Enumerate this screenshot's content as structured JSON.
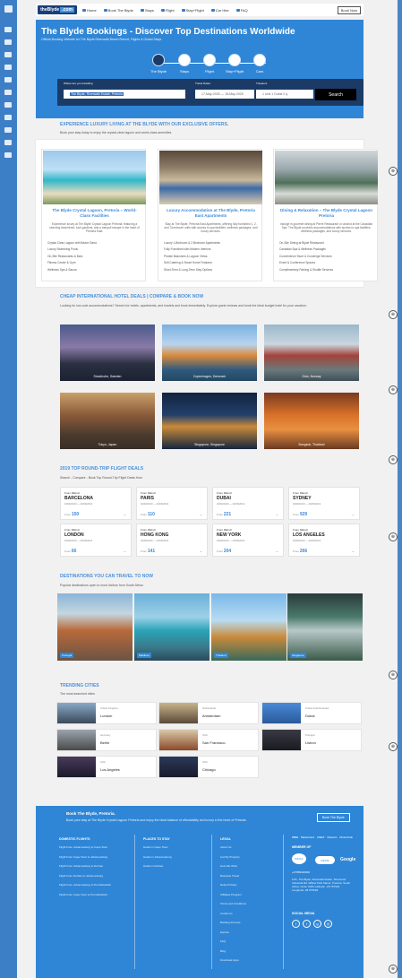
{
  "nav": {
    "logo_a": "theBlyde",
    "logo_b": ".com",
    "links": [
      "Home",
      "Book The Blyde",
      "Stays",
      "Flight",
      "Stay+Flight",
      "Car Hire",
      "FAQ"
    ],
    "book_now": "Book Now"
  },
  "hero": {
    "title": "The Blyde Bookings - Discover Top Destinations Worldwide",
    "subtitle": "Official Booking Website for The Blyde Riverwalk Beach Resort, Flights & Global Stays",
    "steps": [
      "The Blyde",
      "Stays",
      "Flight",
      "Stay+Flight",
      "Cars"
    ],
    "search": {
      "dest_label": "Where are you travelling",
      "dest_value": "The Blyde, Riverwalk Estate, Pretoria",
      "dates_label": "Travel Dates",
      "dates_value": "17-May-2025 — 18-May-2025",
      "travelers_label": "Travelers",
      "travelers_value": "1 Unit 1 Guest 0 q",
      "button": "Search"
    }
  },
  "luxury": {
    "title": "EXPERIENCE LUXURY LIVING AT THE BLYDE WITH OUR EXCLUSIVE OFFERS.",
    "subtitle": "Book your stay today to enjoy the crystal-clear lagoon and world-class amenities.",
    "cards": [
      {
        "title": "The Blyde Crystal Lagoon, Pretoria – World-Class Facilities",
        "desc": "Experience luxury at The Blyde Crystal Lagoon Pretoria, featuring a stunning beachfront, lush gardens, and a tranquil escape in the heart of Pretoria East.",
        "items": [
          "Crystal Clear Lagoon with Beach Sand",
          "Luxury Swimming Pools",
          "On-Site Restaurants & Bars",
          "Fitness Center & Gym",
          "Wellness Spa & Sauna"
        ]
      },
      {
        "title": "Luxury Accommodation at The Blyde, Pretoria East Apartments",
        "desc": "Stay at The Blyde, Pretoria East Apartments, offering fully furnished 1, 2, and 3-bedroom units with access to spa facilities, wellness packages, and luxury services.",
        "items": [
          "Luxury 1-Bedroom & 2-Bedroom Apartments",
          "Fully Furnished with Modern Interiors",
          "Private Balconies & Lagoon Views",
          "Self-Catering & Smart Home Features",
          "Short-Term & Long-Term Stay Options"
        ]
      },
      {
        "title": "Dining & Relaxation – The Blyde Crystal Lagoon Pretoria",
        "desc": "Indulge in gourmet dining at Pierre Restaurant or unwind at the Canadian Spa. The Blyde provides accommodations with access to spa facilities, wellness packages, and luxury services.",
        "items": [
          "On-Site Dining at Blyde Restaurant",
          "Canadian Spa & Wellness Packages",
          "Convenience Store & Concierge Services",
          "Event & Conference Spaces",
          "Complimentary Parking & Shuttle Services"
        ]
      }
    ]
  },
  "cheap": {
    "title": "CHEAP INTERNATIONAL HOTEL DEALS | COMPARE & BOOK NOW",
    "subtitle": "Looking for low-cost accommodations? Search for hotels, apartments, and hostels and book immediately. Explore guest reviews and book the ideal budget hotel for your vacation.",
    "cities": [
      "Stockholm, Sweden",
      "Copenhagen, Denmark",
      "Oslo, Norway",
      "Tokyo, Japan",
      "Singapore, Singapore",
      "Bangkok, Thailand"
    ]
  },
  "flights": {
    "title": "2019 TOP ROUND-TRIP FLIGHT DEALS",
    "subtitle": "Search - Compare - Book Top Round-Trip Flight Deals from",
    "from_label": "From",
    "dates": "04/09/2019  —  20/09/2019",
    "price_label": "From",
    "cards": [
      {
        "from": "DELHI",
        "to": "BARCELONA",
        "price": "150"
      },
      {
        "from": "DELHI",
        "to": "PARIS",
        "price": "110"
      },
      {
        "from": "DELHI",
        "to": "DUBAI",
        "price": "221"
      },
      {
        "from": "DELHI",
        "to": "SYDNEY",
        "price": "929"
      },
      {
        "from": "DELHI",
        "to": "LONDON",
        "price": "66"
      },
      {
        "from": "DELHI",
        "to": "HONG KONG",
        "price": "141"
      },
      {
        "from": "DELHI",
        "to": "NEW YORK",
        "price": "204"
      },
      {
        "from": "DELHI",
        "to": "LOS ANGELES",
        "price": "266"
      }
    ]
  },
  "destinations": {
    "title": "DESTINATIONS YOU CAN TRAVEL TO NOW",
    "subtitle": "Popular destinations open to most visitors from South Africa",
    "tags": [
      "Portugal",
      "Maldives",
      "Thailand",
      "Singapore"
    ]
  },
  "trending": {
    "title": "TRENDING CITIES",
    "subtitle": "The most searched cities",
    "cities": [
      {
        "country": "United Kingdom",
        "name": "London"
      },
      {
        "country": "Netherlands",
        "name": "Amsterdam"
      },
      {
        "country": "United Arab Emirates",
        "name": "Dubai"
      },
      {
        "country": "Germany",
        "name": "Berlin"
      },
      {
        "country": "USA",
        "name": "San Francisco"
      },
      {
        "country": "Portugal",
        "name": "Lisbon"
      },
      {
        "country": "USA",
        "name": "Los Angeles"
      },
      {
        "country": "USA",
        "name": "Chicago"
      }
    ]
  },
  "footer": {
    "cta_title": "Book The Blyde, Pretoria.",
    "cta_text": "Book your stay at The Blyde Crystal Lagoon Pretoria and enjoy the ideal balance of affordability and luxury in the heart of Pretoria.",
    "cta_button": "Book The Blyde",
    "col1_title": "DOMESTIC FLIGHTS",
    "col1": [
      "Flight From Johannesburg to Cape Town",
      "Flight From Cape Town to Johannesburg",
      "Flight From Johannesburg to Durban",
      "Flight From Durban to Johannesburg",
      "Flight From Johannesburg to Port Elizabeth",
      "Flight From Cape Town to Port Elizabeth"
    ],
    "col2_title": "PLACES TO STAY",
    "col2": [
      "Hotels in Cape Town",
      "Hotels in Johannesburg",
      "Hotels in Durban"
    ],
    "col3_title": "LEGAL",
    "col3": [
      "About Us",
      "List My Property",
      "How We Work",
      "Business Travel",
      "Refund Policy",
      "Affiliates Program",
      "Terms and Conditions",
      "contact us",
      "Booking Process",
      "Explore",
      "FAQ",
      "Blog",
      "Download Apps"
    ],
    "member_of": "MEMBER OF",
    "phone": "+27659310640",
    "address": "1/41, The Blyde, Riverwalk Estate, Sherwood Industrial Rd, Willow Park Manor, Pretoria, South Africa, Code: 0184 Latitude: -25.757943 Longitude: 28.375539",
    "social": "SOCIAL MEDIA",
    "badges": [
      "IDOLA",
      "ASATA",
      "Google"
    ],
    "pay": [
      "VISA",
      "Mastercard",
      "AMEX",
      "Maestro",
      "DinersClub"
    ]
  },
  "colors": {
    "brand": "#2f86d6",
    "navy": "#1b3b66",
    "accent": "#4a90d9"
  }
}
